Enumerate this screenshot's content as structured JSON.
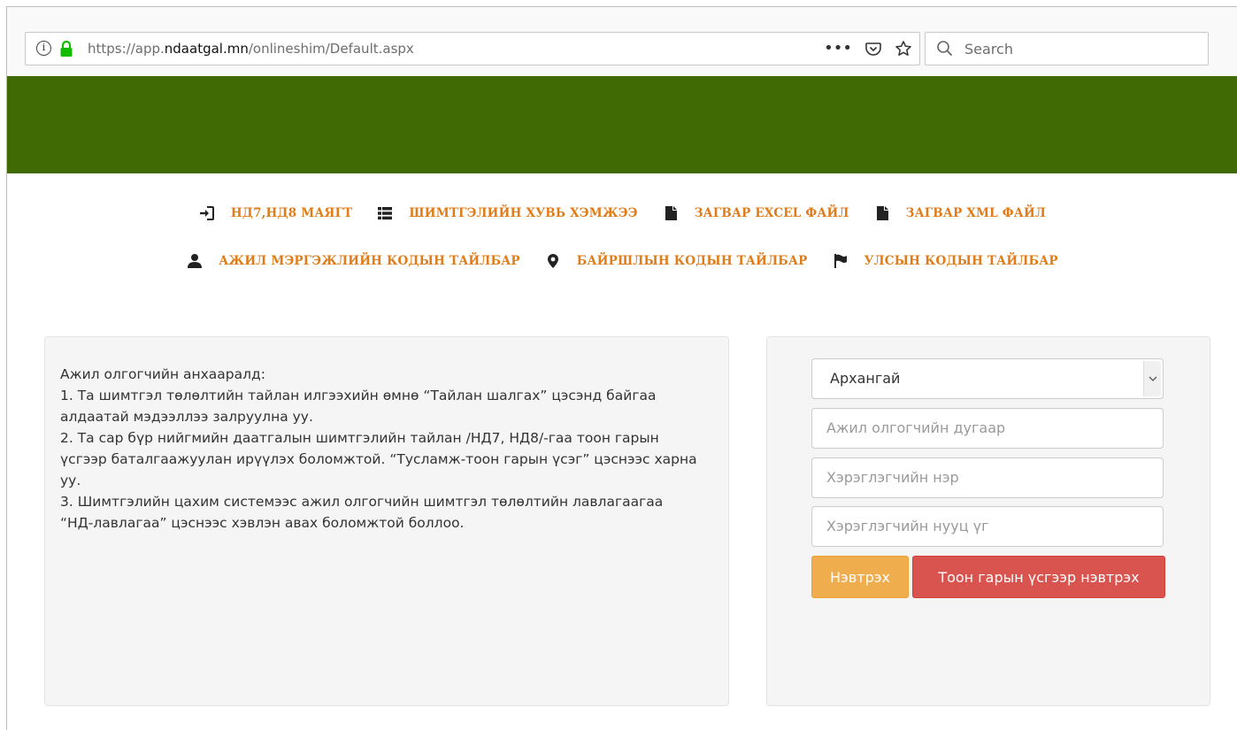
{
  "browser": {
    "url_prefix": "https://app.",
    "url_domain": "ndaatgal.mn",
    "url_path": "/onlineshim/Default.aspx",
    "more_label": "•••",
    "search_placeholder": "Search"
  },
  "nav": {
    "row1": [
      {
        "icon": "sign-in-icon",
        "label": "НД7,НД8 МАЯГТ"
      },
      {
        "icon": "list-icon",
        "label": "ШИМТГЭЛИЙН ХУВЬ ХЭМЖЭЭ"
      },
      {
        "icon": "file-icon",
        "label": "ЗАГВАР EXCEL ФАЙЛ"
      },
      {
        "icon": "file-icon",
        "label": "ЗАГВАР XML ФАЙЛ"
      }
    ],
    "row2": [
      {
        "icon": "user-icon",
        "label": "АЖИЛ МЭРГЭЖЛИЙН КОДЫН ТАЙЛБАР"
      },
      {
        "icon": "map-marker-icon",
        "label": "БАЙРШЛЫН КОДЫН ТАЙЛБАР"
      },
      {
        "icon": "flag-icon",
        "label": "УЛСЫН КОДЫН ТАЙЛБАР"
      }
    ]
  },
  "notice": {
    "text": "Ажил олгогчийн анхааралд:\n1. Та шимтгэл төлөлтийн тайлан илгээхийн өмнө “Тайлан шалгах” цэсэнд байгаа алдаатай мэдээллээ залруулна уу.\n2. Та сар бүр нийгмийн даатгалын шимтгэлийн тайлан /НД7, НД8/-гаа тоон гарын үсгээр баталгаажуулан ирүүлэх боломжтой. “Тусламж-тоон гарын үсэг” цэснээс харна уу.\n3. Шимтгэлийн цахим системээс ажил олгогчийн шимтгэл төлөлтийн лавлагаагаа “НД-лавлагаа” цэснээс хэвлэн авах боломжтой боллоо."
  },
  "login": {
    "province_selected": "Архангай",
    "employer_placeholder": "Ажил олгогчийн дугаар",
    "username_placeholder": "Хэрэглэгчийн нэр",
    "password_placeholder": "Хэрэглэгчийн нууц үг",
    "login_button": "Нэвтрэх",
    "digital_sign_button": "Тоон гарын үсгээр нэвтрэх"
  },
  "colors": {
    "header_green": "#3f6a04",
    "nav_link": "#e07c1a",
    "login_button": "#f0ad4e",
    "sign_button": "#d9534f"
  }
}
